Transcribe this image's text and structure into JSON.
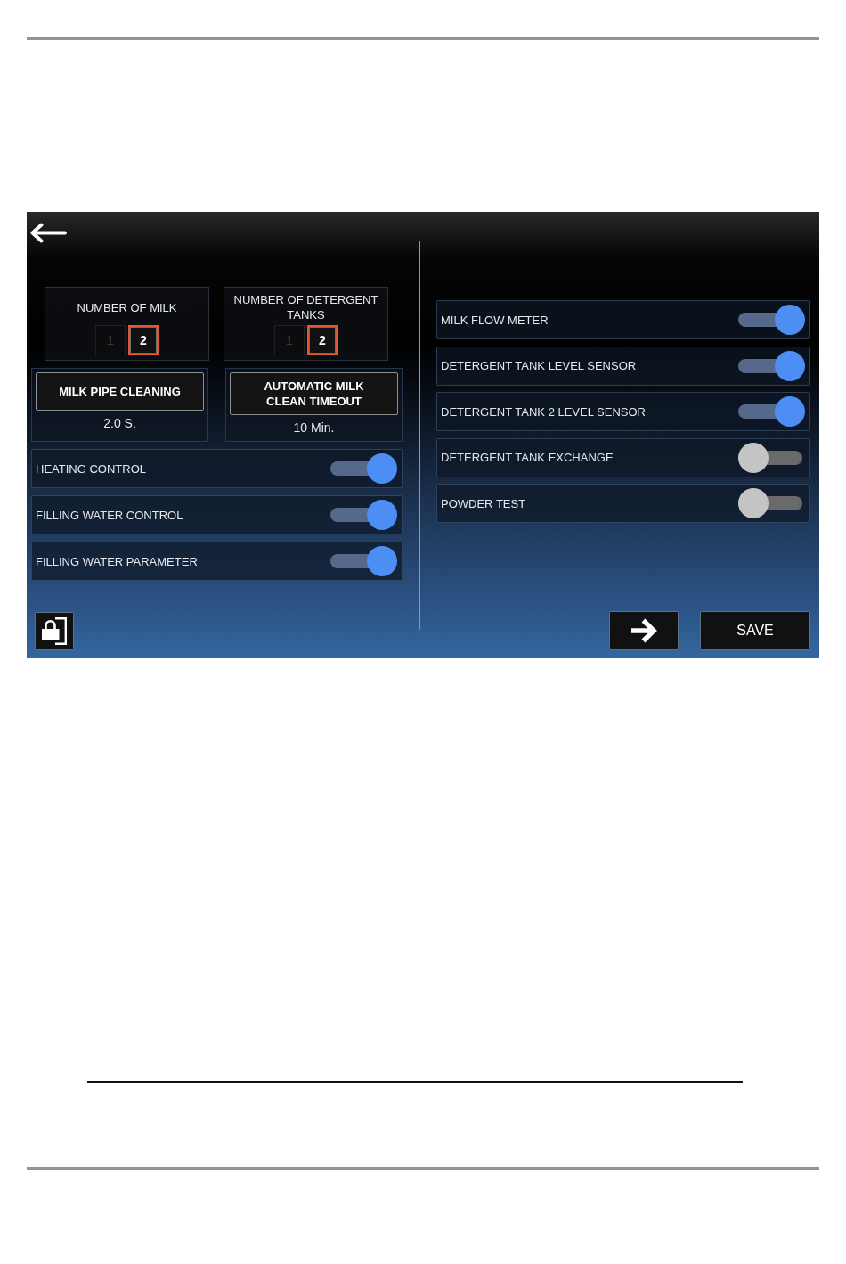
{
  "screen": {
    "selectors": [
      {
        "title": "NUMBER OF MILK",
        "options": [
          {
            "label": "1",
            "selected": false
          },
          {
            "label": "2",
            "selected": true
          }
        ]
      },
      {
        "title": "NUMBER OF DETERGENT TANKS",
        "options": [
          {
            "label": "1",
            "selected": false
          },
          {
            "label": "2",
            "selected": true
          }
        ]
      }
    ],
    "timers": [
      {
        "label": "MILK PIPE CLEANING",
        "value": "2.0 S."
      },
      {
        "label": "AUTOMATIC MILK CLEAN TIMEOUT",
        "value": "10 Min."
      }
    ],
    "left_settings": [
      {
        "label": "HEATING CONTROL",
        "on": true
      },
      {
        "label": "FILLING WATER CONTROL",
        "on": true
      },
      {
        "label": "FILLING WATER PARAMETER",
        "on": true
      }
    ],
    "right_settings": [
      {
        "label": "MILK FLOW METER",
        "on": true
      },
      {
        "label": "DETERGENT TANK LEVEL SENSOR",
        "on": true
      },
      {
        "label": "DETERGENT TANK 2 LEVEL SENSOR",
        "on": true
      },
      {
        "label": "DETERGENT TANK EXCHANGE",
        "on": false
      },
      {
        "label": "POWDER TEST",
        "on": false
      }
    ],
    "save_button": "SAVE"
  }
}
